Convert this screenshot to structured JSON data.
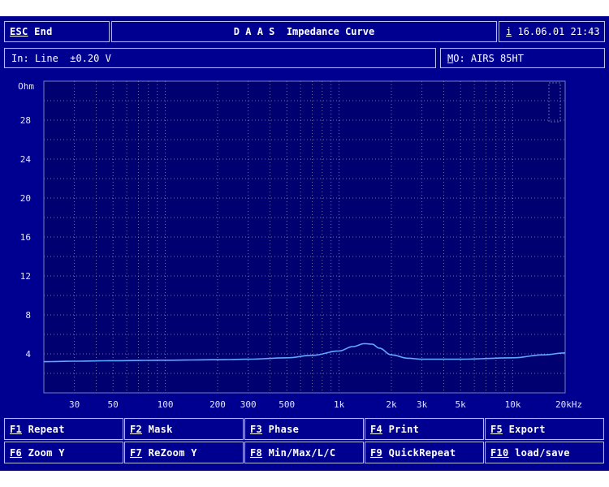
{
  "header": {
    "esc_key": "ESC",
    "esc_label": "End",
    "title": "D A A S  Impedance Curve",
    "info_key": "i",
    "datetime": "16.06.01 21:43"
  },
  "status": {
    "input": "In: Line  ±0.20 V",
    "memory_key": "M",
    "memory_rest": "O: AIRS 85HT"
  },
  "function_keys": [
    {
      "key": "F1",
      "label": "Repeat"
    },
    {
      "key": "F2",
      "label": "Mask"
    },
    {
      "key": "F3",
      "label": "Phase"
    },
    {
      "key": "F4",
      "label": "Print"
    },
    {
      "key": "F5",
      "label": "Export"
    },
    {
      "key": "F6",
      "label": "Zoom Y"
    },
    {
      "key": "F7",
      "label": "ReZoom Y"
    },
    {
      "key": "F8",
      "label": "Min/Max/L/C"
    },
    {
      "key": "F9",
      "label": "QuickRepeat"
    },
    {
      "key": "F10",
      "label": "load/save"
    }
  ],
  "colors": {
    "background": "#000090",
    "plot_background": "#000070",
    "grid": "#8890c8",
    "curve": "#5fa8ff",
    "border": "#b8c0e8"
  },
  "chart_data": {
    "type": "line",
    "title": "",
    "xlabel": "",
    "ylabel": "Ohm",
    "x_unit": "kHz",
    "x_scale": "log",
    "xlim": [
      20,
      20000
    ],
    "ylim": [
      0,
      32
    ],
    "grid": true,
    "y_ticks": [
      {
        "value": 4,
        "label": "4"
      },
      {
        "value": 8,
        "label": "8"
      },
      {
        "value": 12,
        "label": "12"
      },
      {
        "value": 16,
        "label": "16"
      },
      {
        "value": 20,
        "label": "20"
      },
      {
        "value": 24,
        "label": "24"
      },
      {
        "value": 28,
        "label": "28"
      }
    ],
    "y_axis_unit_label": "Ohm",
    "x_ticks": [
      {
        "value": 30,
        "label": "30"
      },
      {
        "value": 50,
        "label": "50"
      },
      {
        "value": 100,
        "label": "100"
      },
      {
        "value": 200,
        "label": "200"
      },
      {
        "value": 300,
        "label": "300"
      },
      {
        "value": 500,
        "label": "500"
      },
      {
        "value": 1000,
        "label": "1k"
      },
      {
        "value": 2000,
        "label": "2k"
      },
      {
        "value": 3000,
        "label": "3k"
      },
      {
        "value": 5000,
        "label": "5k"
      },
      {
        "value": 10000,
        "label": "10k"
      },
      {
        "value": 20000,
        "label": "20kHz"
      }
    ],
    "series": [
      {
        "x": [
          20,
          30,
          50,
          100,
          200,
          300,
          500,
          700,
          1000,
          1200,
          1400,
          1550,
          1700,
          2000,
          2500,
          3000,
          5000,
          10000,
          15000,
          20000
        ],
        "values": [
          3.2,
          3.25,
          3.3,
          3.35,
          3.4,
          3.45,
          3.6,
          3.85,
          4.3,
          4.75,
          5.05,
          5.0,
          4.6,
          3.9,
          3.55,
          3.45,
          3.45,
          3.6,
          3.9,
          4.1
        ]
      }
    ]
  }
}
